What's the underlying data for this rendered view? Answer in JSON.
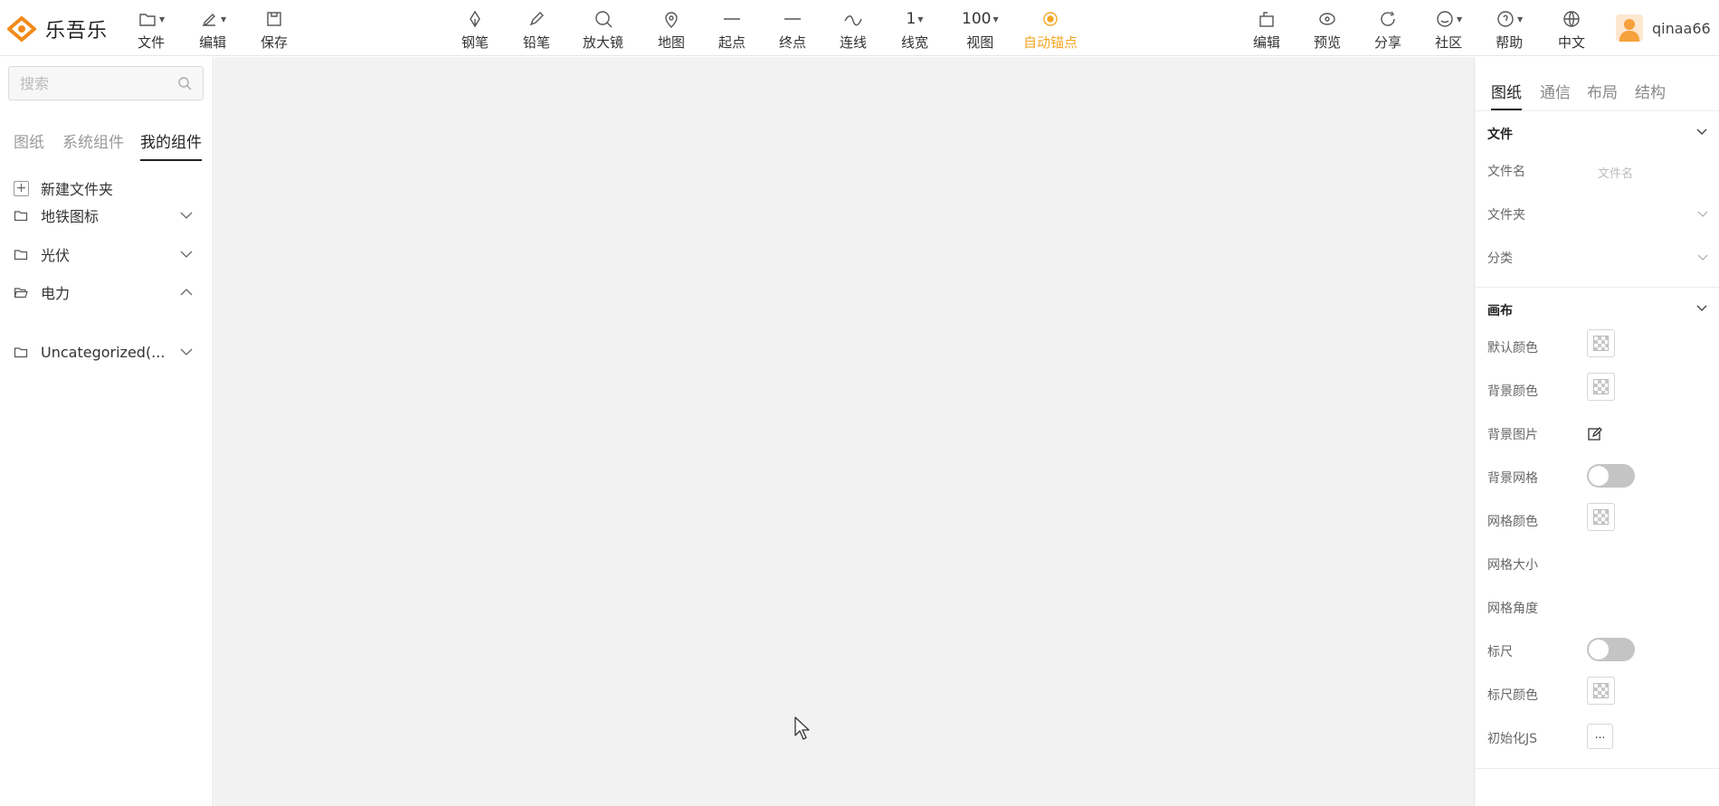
{
  "app": {
    "name": "乐吾乐"
  },
  "toolbar": {
    "file": "文件",
    "edit": "编辑",
    "save": "保存",
    "pen": "钢笔",
    "pencil": "铅笔",
    "magnifier": "放大镜",
    "map": "地图",
    "start_point": "起点",
    "end_point": "终点",
    "connector": "连线",
    "line_width_value": "1",
    "line_width": "线宽",
    "view_value": "100",
    "view": "视图",
    "auto_anchor": "自动锚点",
    "right_edit": "编辑",
    "preview": "预览",
    "share": "分享",
    "community": "社区",
    "help": "帮助",
    "language": "中文",
    "username": "qinaa66"
  },
  "left": {
    "search_placeholder": "搜索",
    "tabs": [
      "图纸",
      "系统组件",
      "我的组件"
    ],
    "new_folder": "新建文件夹",
    "folders": [
      "地铁图标",
      "光伏",
      "电力",
      "Uncategorized(..."
    ]
  },
  "right": {
    "tabs": [
      "图纸",
      "通信",
      "布局",
      "结构"
    ],
    "file_section": {
      "title": "文件",
      "filename_label": "文件名",
      "filename_placeholder": "文件名",
      "folder_label": "文件夹",
      "category_label": "分类"
    },
    "canvas_section": {
      "title": "画布",
      "default_color": "默认颜色",
      "bg_color": "背景颜色",
      "bg_image": "背景图片",
      "bg_grid": "背景网格",
      "grid_color": "网格颜色",
      "grid_size": "网格大小",
      "grid_angle": "网格角度",
      "ruler": "标尺",
      "ruler_color": "标尺颜色",
      "init_js": "初始化JS",
      "init_js_button": "..."
    }
  },
  "colors": {
    "accent": "#f5a623",
    "canvas_bg": "#f2f2f2"
  }
}
